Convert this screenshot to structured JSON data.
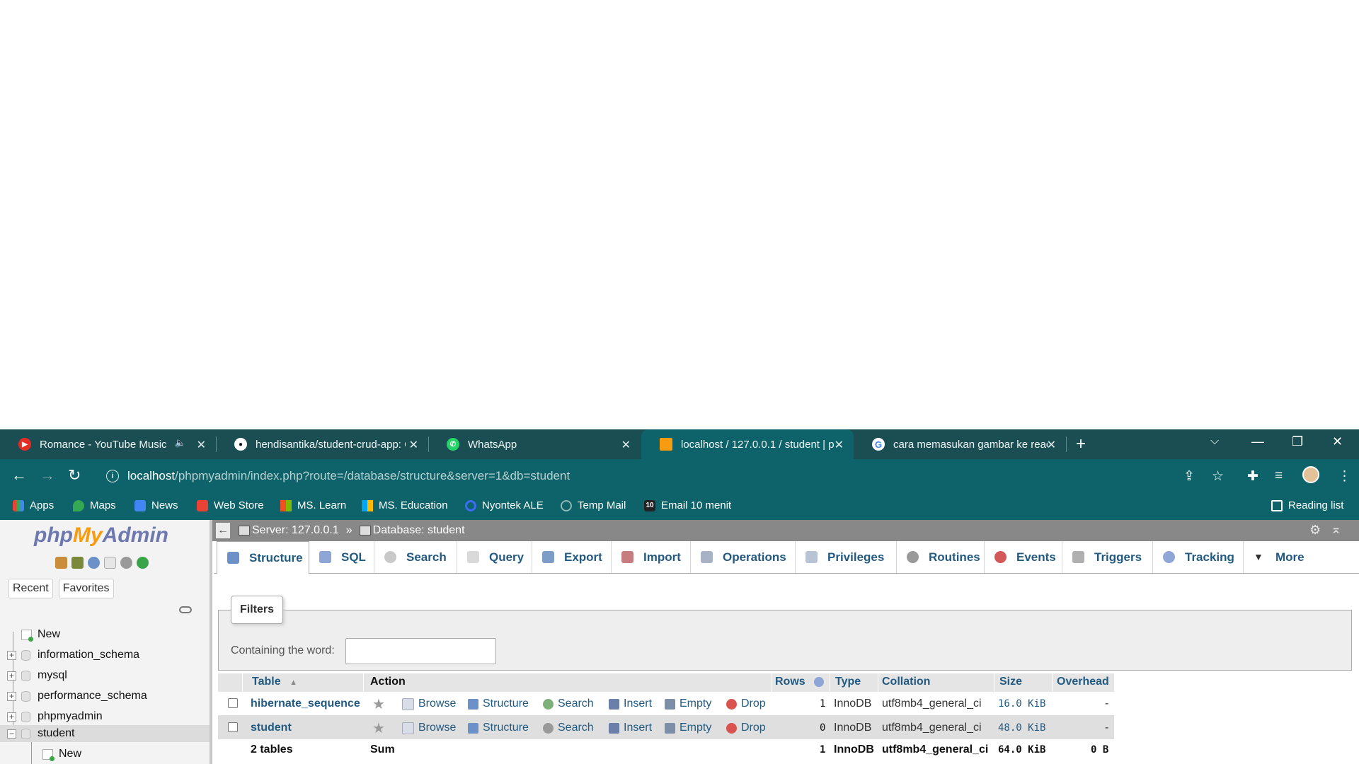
{
  "browser": {
    "tabs": [
      {
        "title": "Romance - YouTube Music",
        "audio": "🔈",
        "icon": "youtube-music-icon"
      },
      {
        "title": "hendisantika/student-crud-app: C",
        "icon": "github-icon"
      },
      {
        "title": "WhatsApp",
        "icon": "whatsapp-icon"
      },
      {
        "title": "localhost / 127.0.0.1 / student | p",
        "icon": "phpmyadmin-icon"
      },
      {
        "title": "cara memasukan gambar ke react",
        "icon": "google-icon"
      }
    ],
    "url_host": "localhost",
    "url_path": "/phpmyadmin/index.php?route=/database/structure&server=1&db=student",
    "bookmarks": [
      {
        "label": "Apps",
        "icon": "apps-grid-icon"
      },
      {
        "label": "Maps",
        "icon": "maps-pin-icon"
      },
      {
        "label": "News",
        "icon": "news-icon"
      },
      {
        "label": "Web Store",
        "icon": "web-store-icon"
      },
      {
        "label": "MS. Learn",
        "icon": "microsoft-icon"
      },
      {
        "label": "MS. Education",
        "icon": "microsoft-icon"
      },
      {
        "label": "Nyontek ALE",
        "icon": "circle-icon"
      },
      {
        "label": "Temp Mail",
        "icon": "temp-mail-icon"
      },
      {
        "label": "Email 10 menit",
        "icon": "ten-icon"
      }
    ],
    "reading_list": "Reading list",
    "colors": {
      "tabstrip": "#1b4e52",
      "toolbar": "#0d6369"
    }
  },
  "pma": {
    "logo": {
      "php": "php",
      "my": "My",
      "admin": "Admin"
    },
    "left_tabs": [
      "Recent",
      "Favorites"
    ],
    "tree": [
      {
        "label": "New",
        "type": "new"
      },
      {
        "label": "information_schema",
        "type": "db"
      },
      {
        "label": "mysql",
        "type": "db"
      },
      {
        "label": "performance_schema",
        "type": "db"
      },
      {
        "label": "phpmyadmin",
        "type": "db"
      },
      {
        "label": "student",
        "type": "db",
        "expanded": true,
        "selected": true
      },
      {
        "label": "New",
        "type": "new-child"
      }
    ],
    "breadcrumb": {
      "server": "Server: 127.0.0.1",
      "separator": "»",
      "database": "Database: student"
    },
    "tabs": [
      {
        "label": "Structure",
        "icon": "structure-icon",
        "active": true
      },
      {
        "label": "SQL",
        "icon": "sql-icon"
      },
      {
        "label": "Search",
        "icon": "search-icon"
      },
      {
        "label": "Query",
        "icon": "query-icon"
      },
      {
        "label": "Export",
        "icon": "export-icon"
      },
      {
        "label": "Import",
        "icon": "import-icon"
      },
      {
        "label": "Operations",
        "icon": "wrench-icon"
      },
      {
        "label": "Privileges",
        "icon": "privileges-icon"
      },
      {
        "label": "Routines",
        "icon": "routines-icon"
      },
      {
        "label": "Events",
        "icon": "clock-icon"
      },
      {
        "label": "Triggers",
        "icon": "triggers-icon"
      },
      {
        "label": "Tracking",
        "icon": "eye-icon"
      },
      {
        "label": "More",
        "icon": "caret-down-icon"
      }
    ],
    "filters": {
      "legend": "Filters",
      "label": "Containing the word:",
      "value": ""
    },
    "table": {
      "headers": {
        "table": "Table",
        "sort": "▲",
        "action": "Action",
        "rows": "Rows",
        "type": "Type",
        "collation": "Collation",
        "size": "Size",
        "overhead": "Overhead"
      },
      "actions": [
        "Browse",
        "Structure",
        "Search",
        "Insert",
        "Empty",
        "Drop"
      ],
      "rows": [
        {
          "name": "hibernate_sequence",
          "rows": "1",
          "type": "InnoDB",
          "collation": "utf8mb4_general_ci",
          "size": "16.0 KiB",
          "overhead": "-"
        },
        {
          "name": "student",
          "rows": "0",
          "type": "InnoDB",
          "collation": "utf8mb4_general_ci",
          "size": "48.0 KiB",
          "overhead": "-"
        }
      ],
      "footer": {
        "tables": "2 tables",
        "sum": "Sum",
        "rows": "1",
        "type": "InnoDB",
        "collation": "utf8mb4_general_ci",
        "size": "64.0 KiB",
        "overhead": "0 B"
      }
    }
  }
}
